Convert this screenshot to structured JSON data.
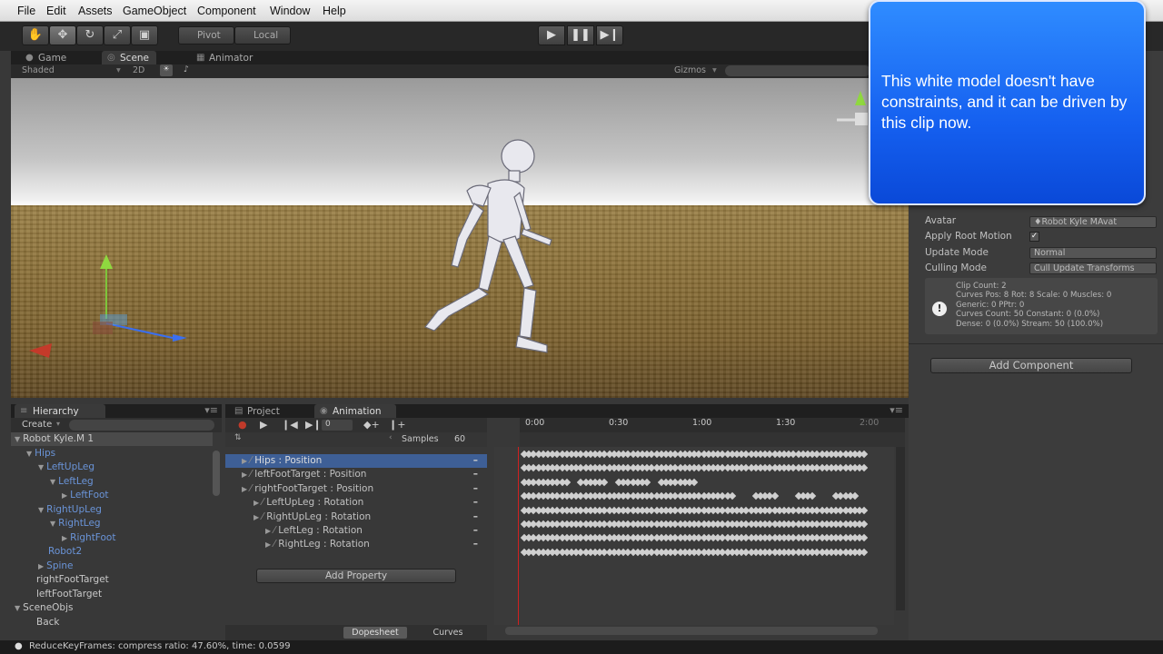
{
  "menubar": {
    "items": [
      "File",
      "Edit",
      "Assets",
      "GameObject",
      "Component",
      "Window",
      "Help"
    ]
  },
  "toolbar": {
    "pivot_label": "Pivot",
    "local_label": "Local",
    "play_icon": "play-icon",
    "pause_icon": "pause-icon",
    "step_icon": "step-icon"
  },
  "view_tabs": [
    "Game",
    "Scene",
    "Animator"
  ],
  "scene_toolbar": {
    "shading": "Shaded",
    "mode_2d": "2D",
    "gizmos": "Gizmos"
  },
  "hierarchy": {
    "tab": "Hierarchy",
    "create_label": "Create",
    "items": [
      {
        "label": "Robot Kyle.M 1",
        "depth": 0,
        "expanded": true,
        "blue": false
      },
      {
        "label": "Hips",
        "depth": 1,
        "expanded": true,
        "blue": true
      },
      {
        "label": "LeftUpLeg",
        "depth": 2,
        "expanded": true,
        "blue": true
      },
      {
        "label": "LeftLeg",
        "depth": 3,
        "expanded": true,
        "blue": true
      },
      {
        "label": "LeftFoot",
        "depth": 4,
        "expanded": false,
        "blue": true
      },
      {
        "label": "RightUpLeg",
        "depth": 2,
        "expanded": true,
        "blue": true
      },
      {
        "label": "RightLeg",
        "depth": 3,
        "expanded": true,
        "blue": true
      },
      {
        "label": "RightFoot",
        "depth": 4,
        "expanded": false,
        "blue": true
      },
      {
        "label": "Robot2",
        "depth": 2,
        "expanded": null,
        "blue": true
      },
      {
        "label": "Spine",
        "depth": 2,
        "expanded": false,
        "blue": true
      },
      {
        "label": "rightFootTarget",
        "depth": 1,
        "expanded": null,
        "blue": false
      },
      {
        "label": "leftFootTarget",
        "depth": 1,
        "expanded": null,
        "blue": false
      },
      {
        "label": "SceneObjs",
        "depth": 0,
        "expanded": true,
        "blue": false
      },
      {
        "label": "Back",
        "depth": 1,
        "expanded": null,
        "blue": false
      }
    ]
  },
  "animation": {
    "tabs": [
      "Project",
      "Animation"
    ],
    "frame_value": "0",
    "samples_label": "Samples",
    "samples_value": "60",
    "timeline_labels": [
      "0:00",
      "0:30",
      "1:00",
      "1:30",
      "2:00"
    ],
    "properties": [
      {
        "label": "Hips : Position",
        "indent": 0,
        "selected": true
      },
      {
        "label": "leftFootTarget : Position",
        "indent": 0,
        "selected": false
      },
      {
        "label": "rightFootTarget : Position",
        "indent": 0,
        "selected": false
      },
      {
        "label": "LeftUpLeg : Rotation",
        "indent": 1,
        "selected": false
      },
      {
        "label": "RightUpLeg : Rotation",
        "indent": 1,
        "selected": false
      },
      {
        "label": "LeftLeg : Rotation",
        "indent": 2,
        "selected": false
      },
      {
        "label": "RightLeg : Rotation",
        "indent": 2,
        "selected": false
      }
    ],
    "add_property": "Add Property",
    "dopesheet_label": "Dopesheet",
    "curves_label": "Curves"
  },
  "inspector": {
    "fields": [
      {
        "label": "Avatar",
        "value": "Robot Kyle MAvat"
      },
      {
        "label": "Apply Root Motion",
        "value": "checked"
      },
      {
        "label": "Update Mode",
        "value": "Normal"
      },
      {
        "label": "Culling Mode",
        "value": "Cull Update Transforms"
      }
    ],
    "info_lines": [
      "Clip Count: 2",
      "Curves Pos: 8 Rot: 8 Scale: 0 Muscles: 0",
      "Generic: 0 PPtr: 0",
      "Curves Count: 50 Constant: 0 (0.0%)",
      "Dense: 0 (0.0%) Stream: 50 (100.0%)"
    ],
    "add_component": "Add Component"
  },
  "callout": {
    "text": "This white model doesn't have constraints, and it can be driven by this clip now."
  },
  "statusbar": {
    "text": "ReduceKeyFrames: compress ratio: 47.60%, time: 0.0599"
  },
  "colors": {
    "selection": "#3e5f96",
    "callout": "#1a66f5",
    "playhead": "#d02020",
    "hierarchy_blue": "#6a94d8"
  }
}
